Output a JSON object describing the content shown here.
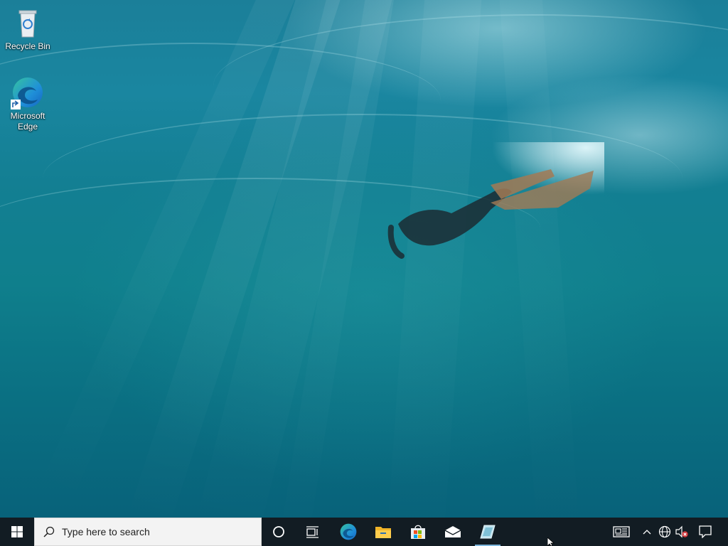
{
  "desktop": {
    "icons": [
      {
        "label": "Recycle Bin",
        "icon": "recycle-bin-icon"
      },
      {
        "label": "Microsoft Edge",
        "icon": "edge-icon"
      }
    ]
  },
  "taskbar": {
    "start_icon": "windows-logo-icon",
    "search": {
      "placeholder": "Type here to search",
      "icon": "search-icon"
    },
    "pinned": [
      {
        "name": "Cortana",
        "icon": "cortana-icon"
      },
      {
        "name": "Task View",
        "icon": "task-view-icon"
      },
      {
        "name": "Microsoft Edge",
        "icon": "edge-icon"
      },
      {
        "name": "File Explorer",
        "icon": "file-explorer-icon"
      },
      {
        "name": "Microsoft Store",
        "icon": "store-icon"
      },
      {
        "name": "Mail",
        "icon": "mail-icon"
      },
      {
        "name": "Open application",
        "icon": "app-window-icon",
        "active": true
      }
    ],
    "tray": [
      {
        "name": "News and interests",
        "icon": "news-icon"
      },
      {
        "name": "Show hidden icons",
        "icon": "chevron-up-icon"
      },
      {
        "name": "Network",
        "icon": "globe-icon"
      },
      {
        "name": "Volume (muted)",
        "icon": "speaker-muted-icon"
      },
      {
        "name": "Action center",
        "icon": "notification-icon"
      }
    ]
  },
  "colors": {
    "taskbar_bg": "#121c23",
    "search_bg": "#f3f3f3",
    "active_indicator": "#7db7dd"
  }
}
